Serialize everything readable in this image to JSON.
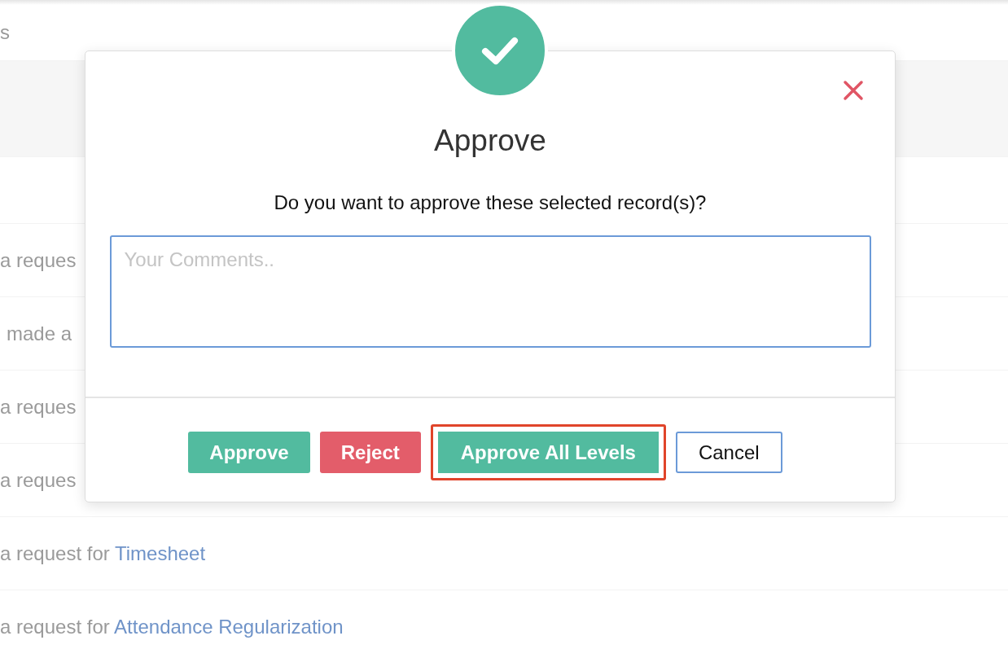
{
  "background": {
    "header": "s",
    "rows": [
      {
        "text": "",
        "shaded": true
      },
      {
        "text": ""
      },
      {
        "text": "a reques"
      },
      {
        "text": "made a"
      },
      {
        "text": "a reques"
      },
      {
        "text": "a reques"
      },
      {
        "text": "a request for ",
        "link": "Timesheet"
      },
      {
        "text": "a request for ",
        "link": "Attendance Regularization"
      }
    ]
  },
  "dialog": {
    "title": "Approve",
    "message": "Do you want to approve these selected record(s)?",
    "comment": {
      "placeholder": "Your Comments.."
    },
    "buttons": [
      {
        "label": "Approve",
        "kind": "success",
        "highlighted": false
      },
      {
        "label": "Reject",
        "kind": "danger",
        "highlighted": false
      },
      {
        "label": "Approve All Levels",
        "kind": "success",
        "highlighted": true
      },
      {
        "label": "Cancel",
        "kind": "outline",
        "highlighted": false
      }
    ]
  }
}
